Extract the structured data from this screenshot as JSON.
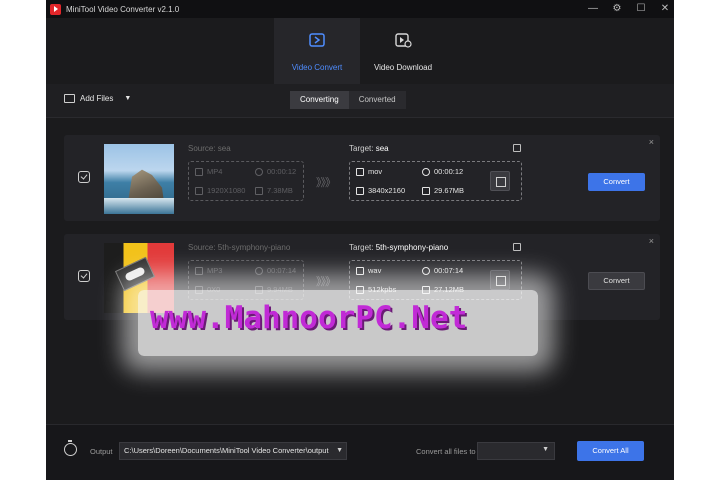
{
  "window": {
    "title": "MiniTool Video Converter v2.1.0",
    "controls": [
      "—",
      "⚙",
      "☐",
      "✕"
    ]
  },
  "tabs": [
    {
      "label": "Video Convert",
      "icon": "convert-icon",
      "active": true
    },
    {
      "label": "Video Download",
      "icon": "download-icon",
      "active": false
    }
  ],
  "toolbar": {
    "add_files": "Add Files",
    "caret": "▼"
  },
  "segments": [
    {
      "label": "Converting",
      "active": true
    },
    {
      "label": "Converted",
      "active": false
    }
  ],
  "rows": [
    {
      "source_title": "Source: sea",
      "source": {
        "format": "MP4",
        "duration": "00:00:12",
        "resolution": "1920X1080",
        "size": "7.38MB"
      },
      "target_label": "Target:",
      "target_name": "sea",
      "target": {
        "format": "mov",
        "duration": "00:00:12",
        "resolution": "3840x2160",
        "size": "29.67MB"
      },
      "button": "Convert",
      "button_style": "blue"
    },
    {
      "source_title": "Source: 5th-symphony-piano",
      "source": {
        "format": "MP3",
        "duration": "00:07:14",
        "resolution": "0X0",
        "size": "9.94MB"
      },
      "target_label": "Target:",
      "target_name": "5th-symphony-piano",
      "target": {
        "format": "wav",
        "duration": "00:07:14",
        "resolution": "512kpbs",
        "size": "27.12MB"
      },
      "button": "Convert",
      "button_style": "grey"
    }
  ],
  "arrows": "》》》",
  "close_glyph": "×",
  "bottom": {
    "output_label": "Output",
    "output_path": "C:\\Users\\Doreen\\Documents\\MiniTool Video Converter\\output",
    "dropdown_glyph": "▼",
    "convert_all_label": "Convert all files to",
    "convert_all_button": "Convert All"
  },
  "watermark": "www.MahnoorPC.Net",
  "colors": {
    "accent": "#3d74e8",
    "active_tab_text": "#4f8dff",
    "background": "#1b1b1d",
    "watermark": "#c12ad6"
  }
}
